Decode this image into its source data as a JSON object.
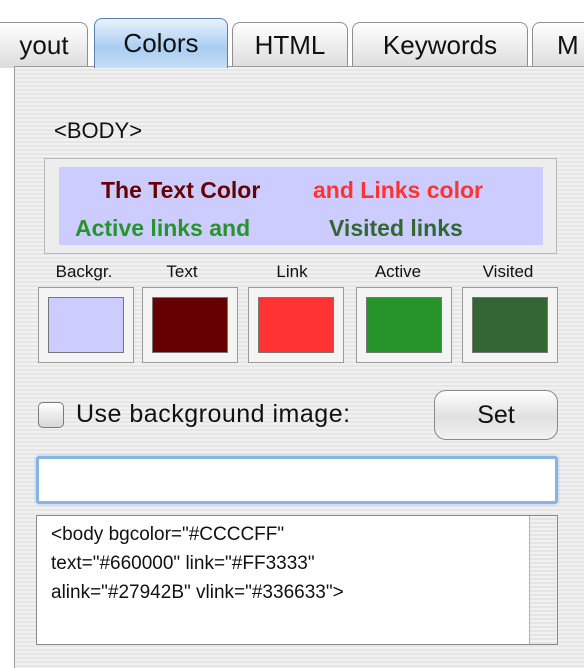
{
  "tabs": [
    {
      "label": "yout"
    },
    {
      "label": "Colors"
    },
    {
      "label": "HTML"
    },
    {
      "label": "Keywords"
    },
    {
      "label": "M"
    }
  ],
  "section_label": "<BODY>",
  "preview": {
    "text_color": "The Text Color",
    "links_color": "and Links color",
    "active_links": "Active links and",
    "visited_links": "Visited links",
    "background_hex": "#CCCCFF"
  },
  "swatches": [
    {
      "label": "Backgr.",
      "color": "#CCCCFF"
    },
    {
      "label": "Text",
      "color": "#660000"
    },
    {
      "label": "Link",
      "color": "#FF3333"
    },
    {
      "label": "Active",
      "color": "#27942B"
    },
    {
      "label": "Visited",
      "color": "#336633"
    }
  ],
  "background_image": {
    "checkbox_label": "Use background image:",
    "checked": false,
    "set_button": "Set",
    "path_value": ""
  },
  "code_lines": [
    "<body bgcolor=\"#CCCCFF\"",
    "text=\"#660000\" link=\"#FF3333\"",
    "alink=\"#27942B\" vlink=\"#336633\">"
  ]
}
